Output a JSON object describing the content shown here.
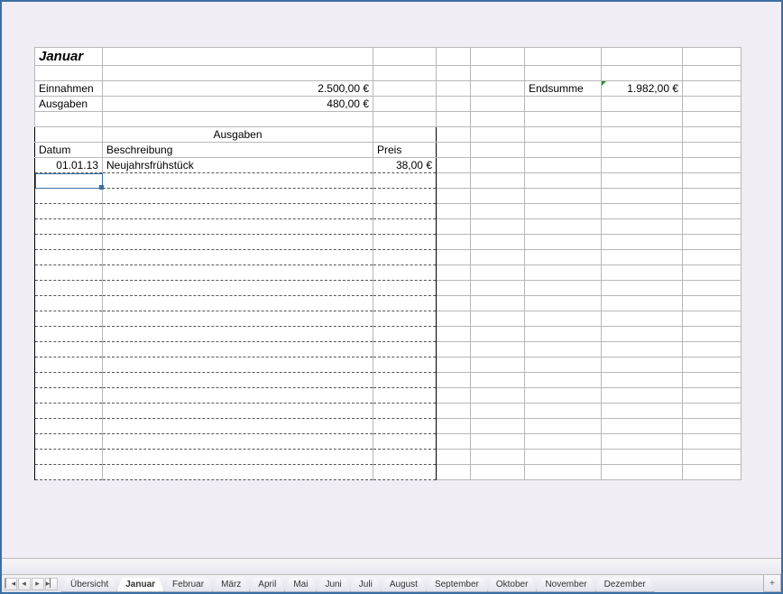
{
  "month_title": "Januar",
  "rows": {
    "einnahmen_label": "Einnahmen",
    "einnahmen_value": "2.500,00 €",
    "ausgaben_label": "Ausgaben",
    "ausgaben_value": "480,00 €",
    "endsumme_label": "Endsumme",
    "endsumme_value": "1.982,00 €"
  },
  "detail": {
    "section_header": "Ausgaben",
    "col_datum": "Datum",
    "col_beschreibung": "Beschreibung",
    "col_preis": "Preis",
    "entry1_date": "01.01.13",
    "entry1_desc": "Neujahrsfrühstück",
    "entry1_price": "38,00 €"
  },
  "tabs": {
    "t0": "Übersicht",
    "t1": "Januar",
    "t2": "Februar",
    "t3": "März",
    "t4": "April",
    "t5": "Mai",
    "t6": "Juni",
    "t7": "Juli",
    "t8": "August",
    "t9": "September",
    "t10": "Oktober",
    "t11": "November",
    "t12": "Dezember"
  },
  "nav": {
    "first": "▏◂",
    "prev": "◂",
    "next": "▸",
    "last": "▸▏",
    "add": "+"
  }
}
